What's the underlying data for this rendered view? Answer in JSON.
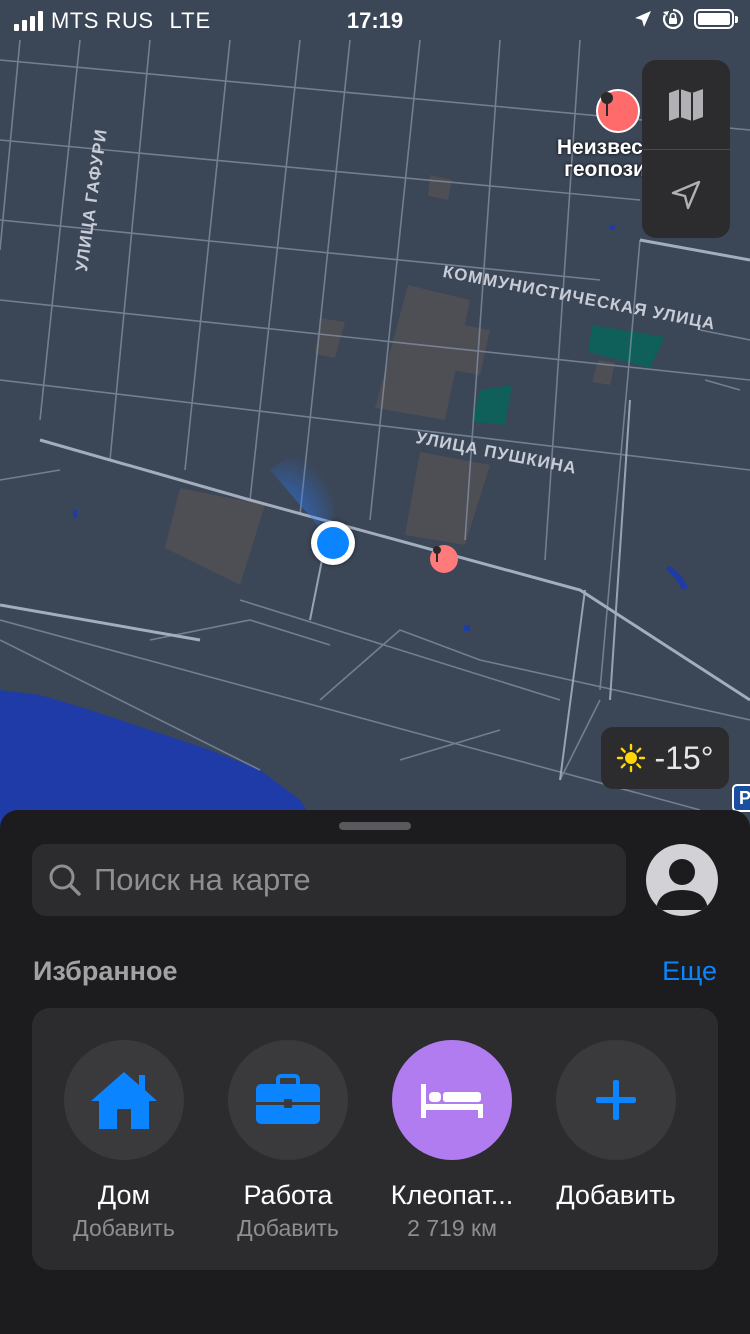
{
  "status": {
    "carrier": "MTS RUS",
    "network": "LTE",
    "time": "17:19"
  },
  "map": {
    "streets": [
      "УЛИЦА ГАФУРИ",
      "КОММУНИСТИЧЕСКАЯ УЛИЦА",
      "УЛИЦА ПУШКИНА"
    ],
    "pin_label_line1": "Неизвест",
    "pin_label_line2": "геопози",
    "parking_letter": "P"
  },
  "weather": {
    "temperature": "-15°",
    "icon": "sun-icon"
  },
  "sheet": {
    "search_placeholder": "Поиск на карте",
    "favorites_title": "Избранное",
    "favorites_more": "Еще",
    "favorites": [
      {
        "icon": "house-icon",
        "name": "Дом",
        "sub": "Добавить",
        "color": "#0a84ff"
      },
      {
        "icon": "briefcase-icon",
        "name": "Работа",
        "sub": "Добавить",
        "color": "#0a84ff"
      },
      {
        "icon": "bed-icon",
        "name": "Клеопат...",
        "sub": "2 719 км",
        "color": "#b07cf0"
      },
      {
        "icon": "plus-icon",
        "name": "Добавить",
        "sub": "",
        "color": "#0a84ff"
      }
    ]
  },
  "colors": {
    "accent": "#0a84ff",
    "map_bg": "#3b4656",
    "sheet_bg": "#1c1c1e"
  }
}
